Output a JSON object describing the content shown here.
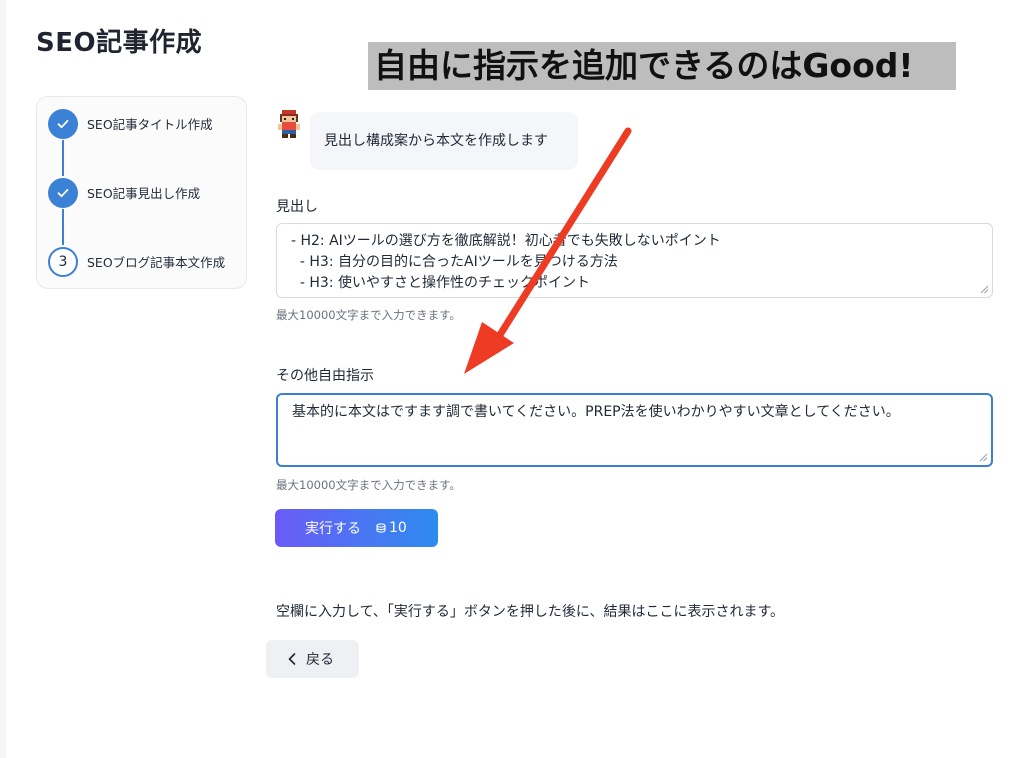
{
  "page": {
    "title": "SEO記事作成"
  },
  "annotation": {
    "text": "自由に指示を追加できるのはGood!"
  },
  "steps": [
    {
      "label": "SEO記事タイトル作成",
      "status": "done"
    },
    {
      "label": "SEO記事見出し作成",
      "status": "done"
    },
    {
      "label": "SEOブログ記事本文作成",
      "status": "current",
      "number": "3"
    }
  ],
  "chat": {
    "message": "見出し構成案から本文を作成します"
  },
  "headings_field": {
    "label": "見出し",
    "lines": [
      "- H2: AIツールの選び方を徹底解説！初心者でも失敗しないポイント",
      "  - H3: 自分の目的に合ったAIツールを見つける方法",
      "  - H3: 使いやすさと操作性のチェックポイント"
    ],
    "hint": "最大10000文字まで入力できます。"
  },
  "instructions_field": {
    "label": "その他自由指示",
    "value": "基本的に本文はですます調で書いてください。PREP法を使いわかりやすい文章としてください。",
    "hint": "最大10000文字まで入力できます。"
  },
  "run_button": {
    "label": "実行する",
    "credits": "10"
  },
  "result_placeholder": "空欄に入力して、「実行する」ボタンを押した後に、結果はここに表示されます。",
  "back_button": {
    "label": "戻る"
  },
  "colors": {
    "accent": "#3b82d6",
    "arrow": "#ee3b24",
    "button_start": "#6b5cf6",
    "button_end": "#2d8cf0"
  }
}
